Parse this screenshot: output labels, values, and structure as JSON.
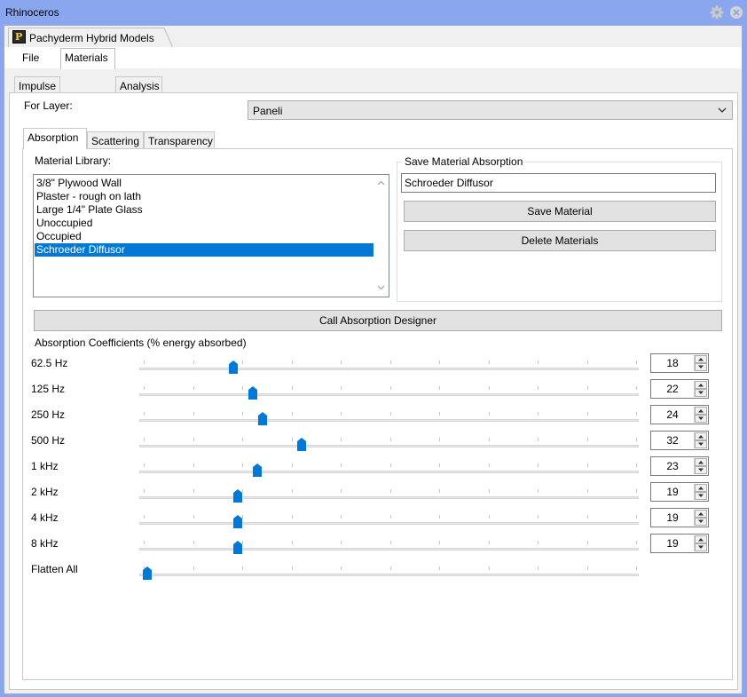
{
  "window": {
    "title": "Rhinoceros",
    "doc_tab": "Pachyderm Hybrid Models"
  },
  "menu": {
    "file": "File"
  },
  "tabs": [
    "Impulse",
    "Materials",
    "Analysis"
  ],
  "layer": {
    "label": "For Layer:",
    "selected": "Paneli"
  },
  "inner_tabs": [
    "Absorption",
    "Scattering",
    "Transparency"
  ],
  "library": {
    "label": "Material Library:",
    "items": [
      "3/8\" Plywood Wall",
      "Plaster - rough on lath",
      "Large 1/4\" Plate Glass",
      "Unoccupied",
      "Occupied",
      "Schroeder Diffusor"
    ],
    "selected_index": 5
  },
  "save": {
    "legend": "Save Material Absorption",
    "name_value": "Schroeder Diffusor",
    "save_button": "Save Material",
    "delete_button": "Delete Materials"
  },
  "designer_button": "Call Absorption Designer",
  "coefficients": {
    "label": "Absorption Coefficients (% energy absorbed)",
    "bands": [
      {
        "name": "62.5 Hz",
        "value": "18"
      },
      {
        "name": "125 Hz",
        "value": "22"
      },
      {
        "name": "250 Hz",
        "value": "24"
      },
      {
        "name": "500 Hz",
        "value": "32"
      },
      {
        "name": "1 kHz",
        "value": "23"
      },
      {
        "name": "2 kHz",
        "value": "19"
      },
      {
        "name": "4 kHz",
        "value": "19"
      },
      {
        "name": "8 kHz",
        "value": "19"
      }
    ],
    "flatten_label": "Flatten All",
    "flatten_value": 0
  },
  "colors": {
    "accent": "#0078d7",
    "titlebar": "#8aa6ef"
  }
}
